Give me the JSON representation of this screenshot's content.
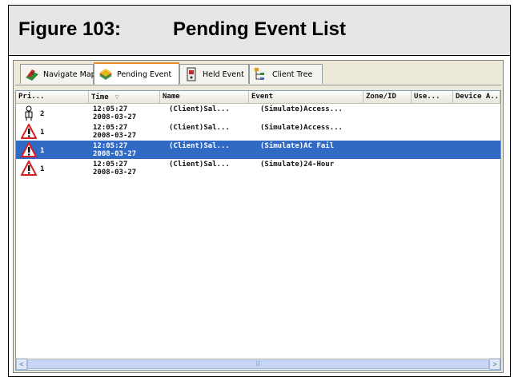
{
  "figure": {
    "label": "Figure 103:",
    "title": "Pending Event List"
  },
  "tabs": [
    {
      "label": "Navigate Map",
      "icon": "map-icon",
      "active": false
    },
    {
      "label": "Pending Event",
      "icon": "pending-event-icon",
      "active": true
    },
    {
      "label": "Held Event",
      "icon": "held-event-icon",
      "active": false
    },
    {
      "label": "Client Tree",
      "icon": "client-tree-icon",
      "active": false
    }
  ],
  "columns": [
    "Pri...",
    "Time",
    "Name",
    "Event",
    "Zone/ID",
    "Use...",
    "Device A.."
  ],
  "sort_indicator": "▽",
  "rows": [
    {
      "icon": "person-icon",
      "priority": "2",
      "time": "12:05:27",
      "date": "2008-03-27",
      "name": "(Client)Sal...",
      "event": "(Simulate)Access...",
      "selected": false
    },
    {
      "icon": "warning-icon",
      "priority": "1",
      "time": "12:05:27",
      "date": "2008-03-27",
      "name": "(Client)Sal...",
      "event": "(Simulate)Access...",
      "selected": false
    },
    {
      "icon": "warning-icon",
      "priority": "1",
      "time": "12:05:27",
      "date": "2008-03-27",
      "name": "(Client)Sal...",
      "event": "(Simulate)AC Fail",
      "selected": true
    },
    {
      "icon": "warning-icon",
      "priority": "1",
      "time": "12:05:27",
      "date": "2008-03-27",
      "name": "(Client)Sal...",
      "event": "(Simulate)24-Hour",
      "selected": false
    }
  ],
  "scrollbar": {
    "left_arrow": "<",
    "right_arrow": ">",
    "grip": "|||"
  },
  "colors": {
    "selection": "#316ac5",
    "title_band": "#e6e6e6",
    "active_tab_accent": "#e68b2c",
    "warning_red": "#d81e1e"
  }
}
